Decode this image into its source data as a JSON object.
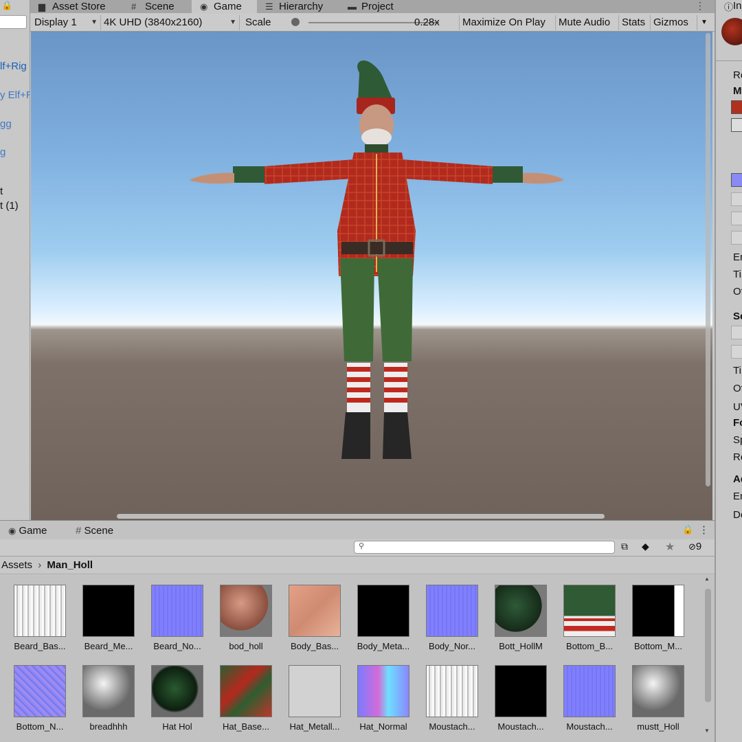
{
  "top_tabs": [
    {
      "label": "Asset Store",
      "icon": "shopping-bag-icon"
    },
    {
      "label": "Scene",
      "icon": "grid-icon"
    },
    {
      "label": "Game",
      "icon": "gamepad-icon"
    },
    {
      "label": "Hierarchy",
      "icon": "list-icon"
    },
    {
      "label": "Project",
      "icon": "folder-icon"
    }
  ],
  "game_toolbar": {
    "display": "Display 1",
    "resolution": "4K UHD (3840x2160)",
    "scale_label": "Scale",
    "scale_value": "0.28x",
    "maximize": "Maximize On Play",
    "mute": "Mute Audio",
    "stats": "Stats",
    "gizmos": "Gizmos"
  },
  "hierarchy": {
    "items": [
      "lf+Rig",
      "y Elf+R",
      "gg",
      "g",
      "t",
      "t (1)"
    ]
  },
  "bottom_tabs": [
    {
      "label": "Game",
      "icon": "gamepad-icon"
    },
    {
      "label": "Scene",
      "icon": "grid-icon"
    }
  ],
  "project_toolbar": {
    "hidden_count": "9"
  },
  "breadcrumb": {
    "root": "Assets",
    "current": "Man_Holl"
  },
  "assets": [
    {
      "label": "Beard_Bas...",
      "kind": "white-streaks"
    },
    {
      "label": "Beard_Me...",
      "kind": "black"
    },
    {
      "label": "Beard_No...",
      "kind": "normal-blue"
    },
    {
      "label": "bod_holl",
      "kind": "sphere-skin"
    },
    {
      "label": "Body_Bas...",
      "kind": "skin-atlas"
    },
    {
      "label": "Body_Meta...",
      "kind": "black"
    },
    {
      "label": "Body_Nor...",
      "kind": "normal-blue"
    },
    {
      "label": "Bott_HollM",
      "kind": "sphere-green"
    },
    {
      "label": "Bottom_B...",
      "kind": "green-red-atlas"
    },
    {
      "label": "Bottom_M...",
      "kind": "black-mask"
    },
    {
      "label": "Bottom_N...",
      "kind": "normal-noisy"
    },
    {
      "label": "breadhhh",
      "kind": "sphere-grey"
    },
    {
      "label": "Hat Hol",
      "kind": "sphere-hat"
    },
    {
      "label": "Hat_Base...",
      "kind": "hat-atlas"
    },
    {
      "label": "Hat_Metall...",
      "kind": "light-grey"
    },
    {
      "label": "Hat_Normal",
      "kind": "normal-colorful"
    },
    {
      "label": "Moustach...",
      "kind": "white-streaks"
    },
    {
      "label": "Moustach...",
      "kind": "black"
    },
    {
      "label": "Moustach...",
      "kind": "normal-blue"
    },
    {
      "label": "mustt_Holl",
      "kind": "sphere-grey"
    }
  ],
  "inspector": {
    "title": "In",
    "labels": [
      "Re",
      "M",
      "Em",
      "Ti",
      "Of",
      "Se",
      "Ti",
      "Of",
      "UV",
      "Fo",
      "Sp",
      "Re",
      "Ad",
      "En",
      "Do"
    ]
  }
}
